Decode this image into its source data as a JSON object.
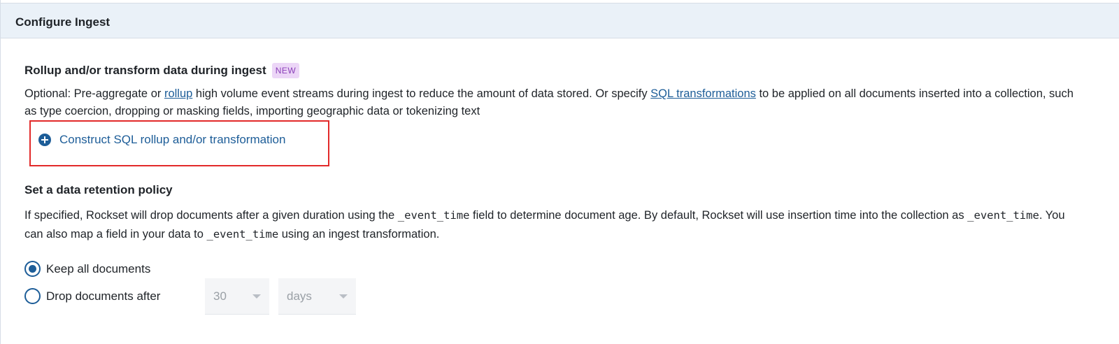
{
  "header": {
    "title": "Configure Ingest"
  },
  "rollup": {
    "title": "Rollup and/or transform data during ingest",
    "badge": "NEW",
    "desc_part1": "Optional: Pre-aggregate or ",
    "rollup_link": "rollup",
    "desc_part2": " high volume event streams during ingest to reduce the amount of data stored. Or specify ",
    "sql_link": "SQL transformations",
    "desc_part3": " to be applied on all documents inserted into a collection, such as type coercion, dropping or masking fields, importing geographic data or tokenizing text",
    "construct_label": "Construct SQL rollup and/or transformation"
  },
  "retention": {
    "title": "Set a data retention policy",
    "desc_part1": "If specified, Rockset will drop documents after a given duration using the ",
    "code1": "_event_time",
    "desc_part2": " field to determine document age. By default, Rockset will use insertion time into the collection as ",
    "code2": "_event_time",
    "desc_part3": ". You can also map a field in your data to ",
    "code3": "_event_time",
    "desc_part4": " using an ingest transformation.",
    "options": [
      {
        "label": "Keep all documents",
        "checked": true
      },
      {
        "label": "Drop documents after",
        "checked": false
      }
    ],
    "duration_value": "30",
    "duration_unit": "days"
  },
  "colors": {
    "accent": "#1d5d98",
    "header_bg": "#eaf1f8",
    "badge_bg": "#ecd6f7",
    "badge_text": "#8a3fb8",
    "highlight": "#e22a2a"
  }
}
